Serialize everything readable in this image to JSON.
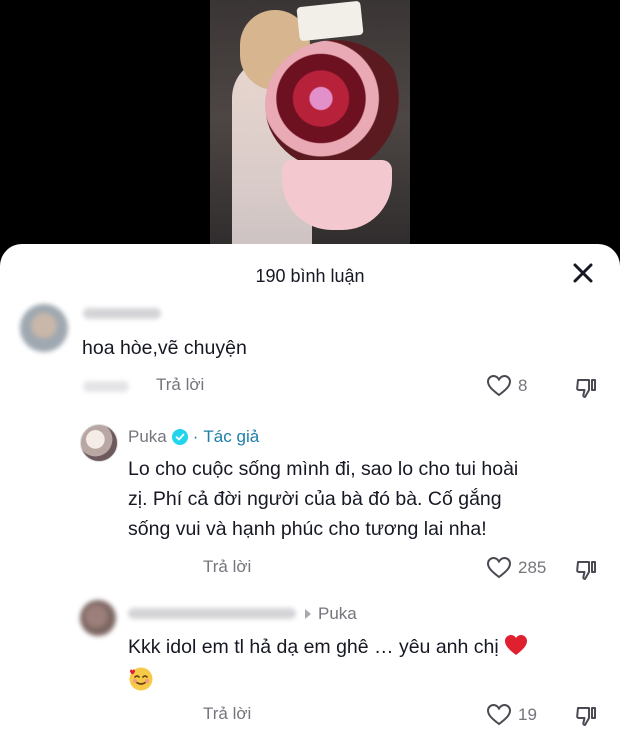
{
  "header": {
    "title": "190 bình luận",
    "close_icon": "close-icon"
  },
  "comments": [
    {
      "text": "hoa hòe,vẽ chuyện",
      "reply_label": "Trả lời",
      "likes": "8"
    },
    {
      "author": "Puka",
      "author_tag": "Tác giả",
      "separator": "·",
      "text_lines": [
        "Lo cho cuộc sống mình đi, sao lo cho tui hoài",
        "zị. Phí cả đời người của bà đó bà. Cố gắng",
        "sống vui và hạnh phúc cho tương lai nha!"
      ],
      "reply_label": "Trả lời",
      "likes": "285"
    },
    {
      "reply_to": "Puka",
      "text": "Kkk idol em tl hả dạ em ghê … yêu anh chị",
      "reply_label": "Trả lời",
      "likes": "19"
    }
  ],
  "colors": {
    "verified": "#20d5ec",
    "tag": "#1d7ea8",
    "muted": "#75757d",
    "heart_emoji": "#e0202e"
  }
}
